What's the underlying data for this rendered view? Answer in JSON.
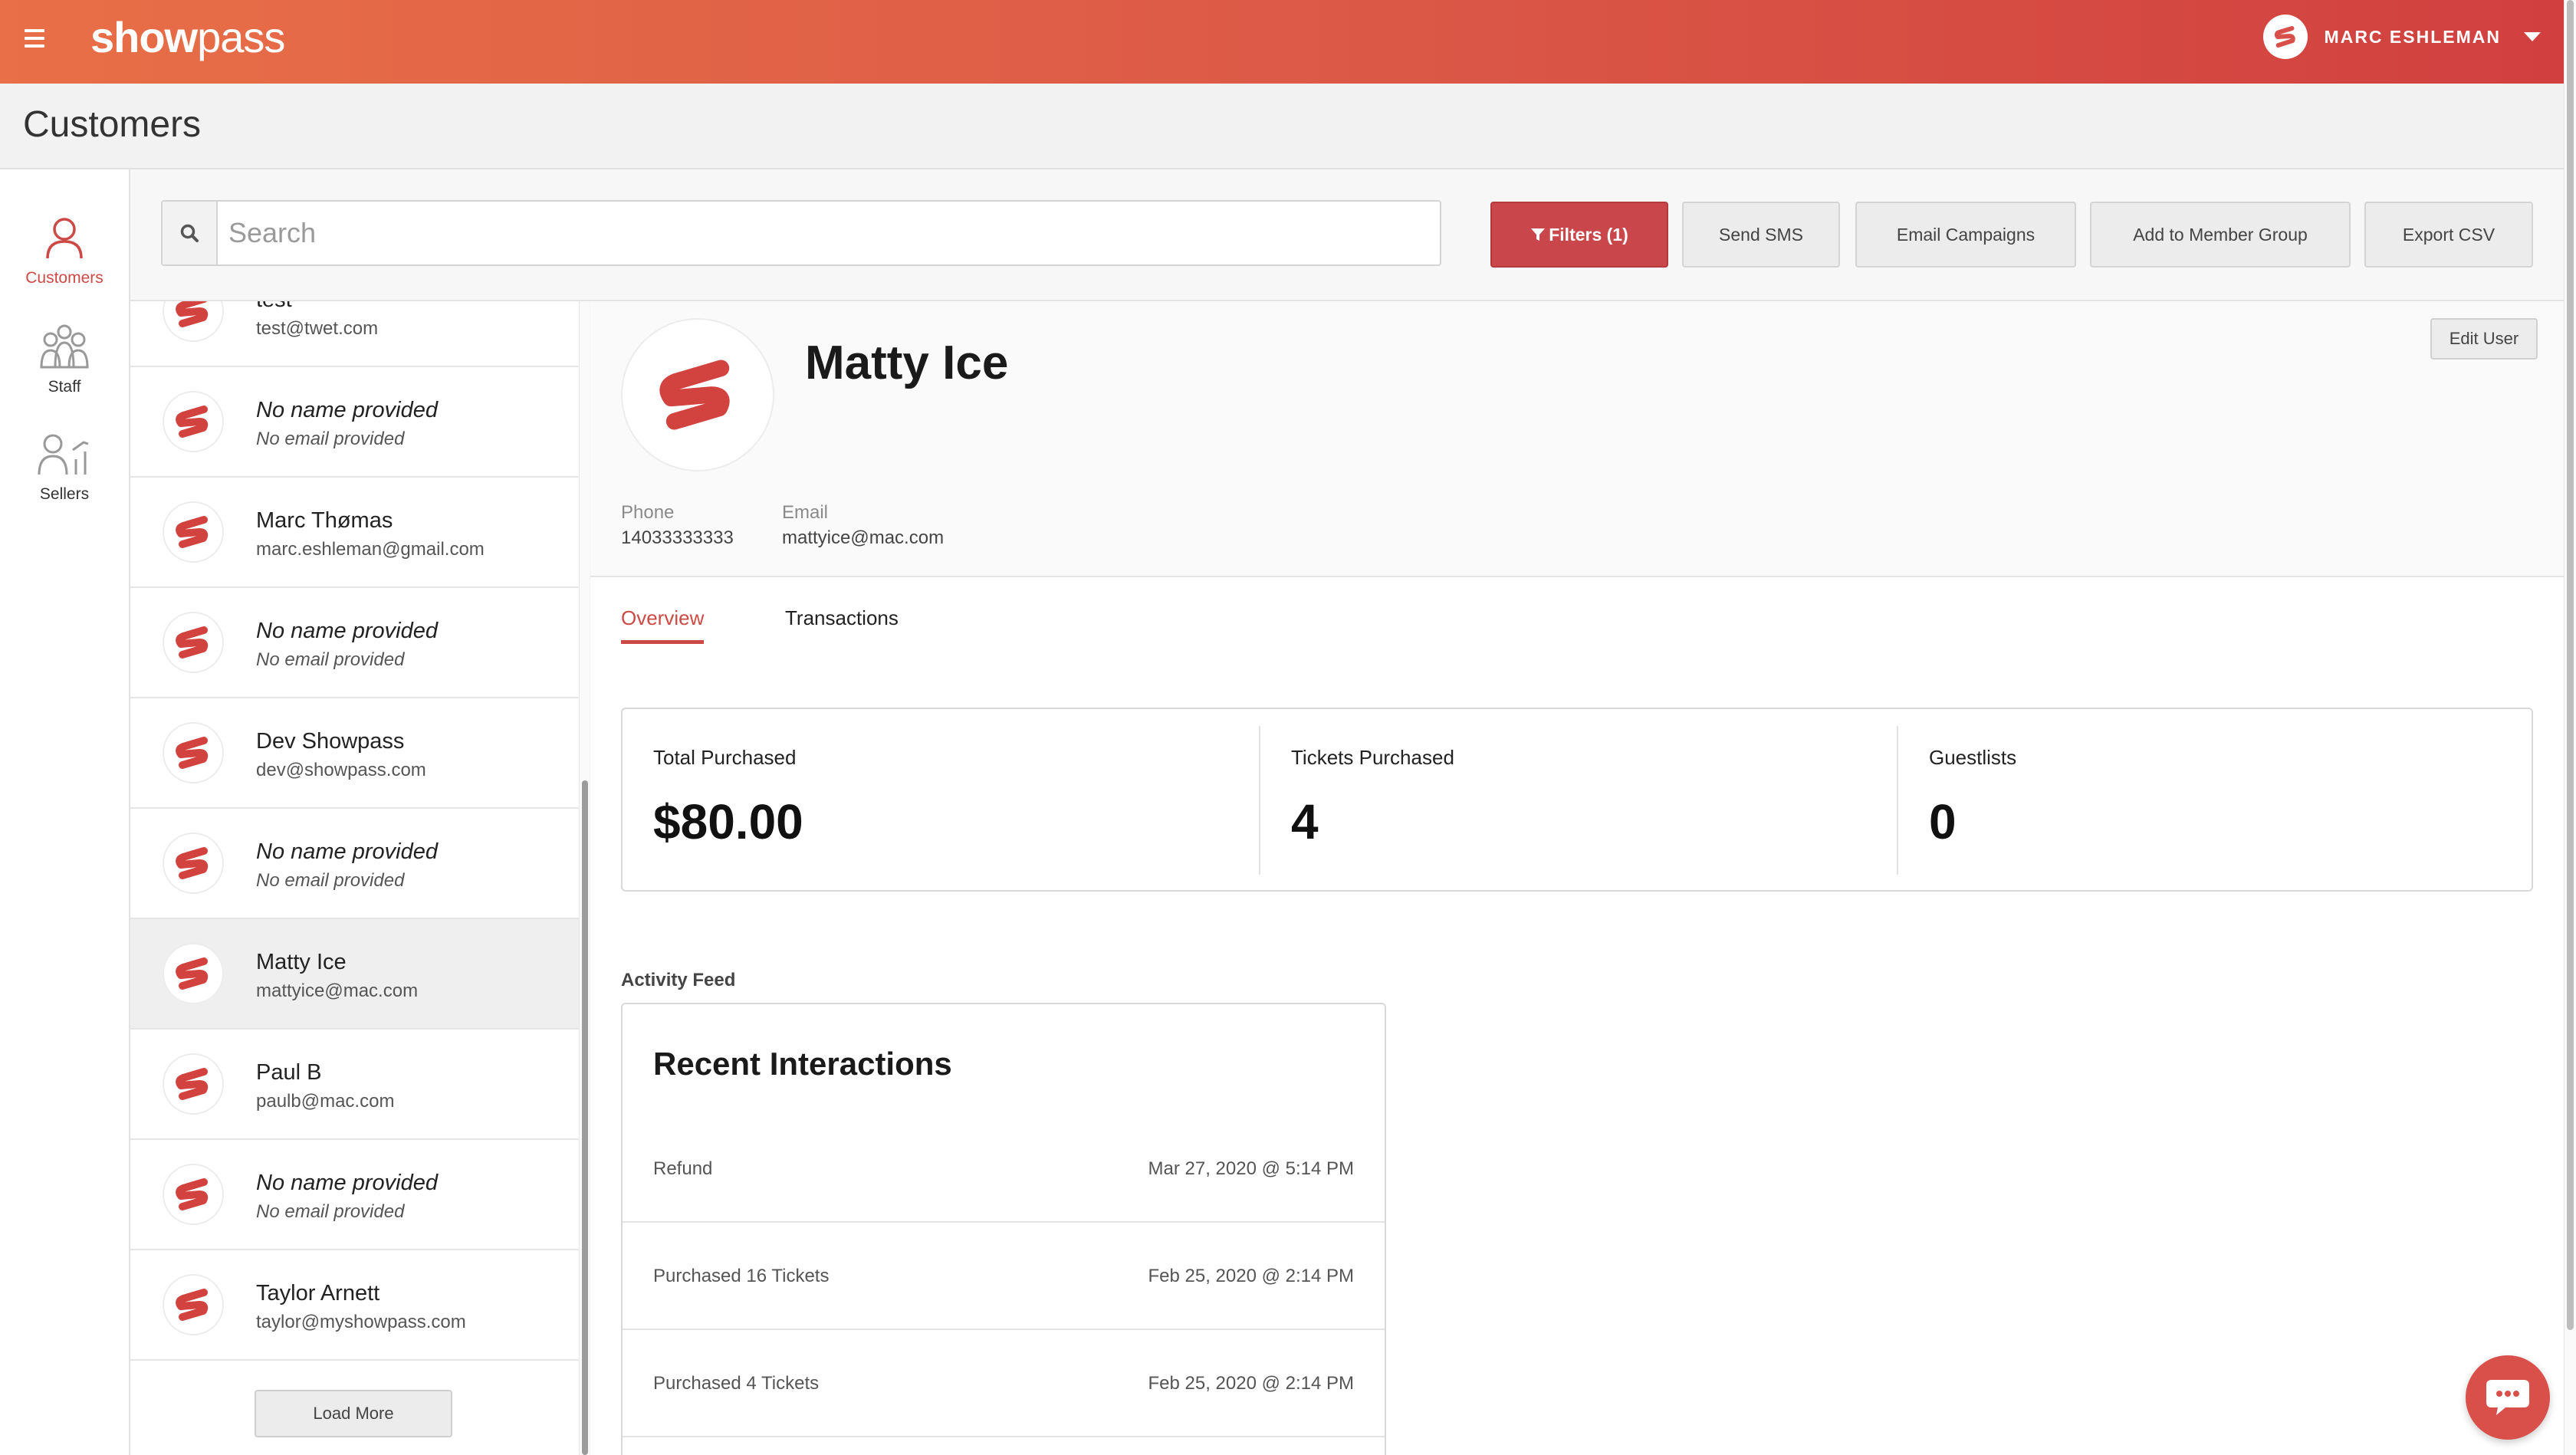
{
  "app": {
    "brand_bold": "show",
    "brand_light": "pass"
  },
  "user_menu": {
    "name": "MARC ESHLEMAN"
  },
  "page": {
    "title": "Customers"
  },
  "nav": [
    {
      "label": "Customers",
      "active": true
    },
    {
      "label": "Staff",
      "active": false
    },
    {
      "label": "Sellers",
      "active": false
    }
  ],
  "search": {
    "placeholder": "Search",
    "value": ""
  },
  "toolbar": {
    "filters": "Filters (1)",
    "send_sms": "Send SMS",
    "email_campaigns": "Email Campaigns",
    "add_member_group": "Add to Member Group",
    "export_csv": "Export CSV"
  },
  "customers": [
    {
      "name": "test",
      "email": "test@twet.com",
      "placeholder": false
    },
    {
      "name": "No name provided",
      "email": "No email provided",
      "placeholder": true
    },
    {
      "name": "Marc Thømas",
      "email": "marc.eshleman@gmail.com",
      "placeholder": false
    },
    {
      "name": "No name provided",
      "email": "No email provided",
      "placeholder": true
    },
    {
      "name": "Dev Showpass",
      "email": "dev@showpass.com",
      "placeholder": false
    },
    {
      "name": "No name provided",
      "email": "No email provided",
      "placeholder": true
    },
    {
      "name": "Matty Ice",
      "email": "mattyice@mac.com",
      "placeholder": false,
      "selected": true
    },
    {
      "name": "Paul B",
      "email": "paulb@mac.com",
      "placeholder": false
    },
    {
      "name": "No name provided",
      "email": "No email provided",
      "placeholder": true
    },
    {
      "name": "Taylor Arnett",
      "email": "taylor@myshowpass.com",
      "placeholder": false
    }
  ],
  "load_more": "Load More",
  "profile": {
    "name": "Matty Ice",
    "edit_label": "Edit User",
    "phone_label": "Phone",
    "phone": "14033333333",
    "email_label": "Email",
    "email": "mattyice@mac.com"
  },
  "tabs": [
    {
      "label": "Overview",
      "active": true
    },
    {
      "label": "Transactions",
      "active": false
    }
  ],
  "stats": [
    {
      "label": "Total Purchased",
      "value": "$80.00"
    },
    {
      "label": "Tickets Purchased",
      "value": "4"
    },
    {
      "label": "Guestlists",
      "value": "0"
    }
  ],
  "activity": {
    "section_label": "Activity Feed",
    "title": "Recent Interactions",
    "items": [
      {
        "action": "Refund",
        "time": "Mar 27, 2020 @ 5:14 PM"
      },
      {
        "action": "Purchased 16 Tickets",
        "time": "Feb 25, 2020 @ 2:14 PM"
      },
      {
        "action": "Purchased 4 Tickets",
        "time": "Feb 25, 2020 @ 2:14 PM"
      }
    ]
  },
  "colors": {
    "brand": "#d9504a",
    "accent": "#cc4a45",
    "filters_button": "#c9474a"
  },
  "icons": {
    "menu": "hamburger-icon",
    "search": "search-icon",
    "filter": "filter-icon",
    "avatar": "showpass-ticket-logo-icon",
    "chat": "chat-bubble-icon"
  }
}
